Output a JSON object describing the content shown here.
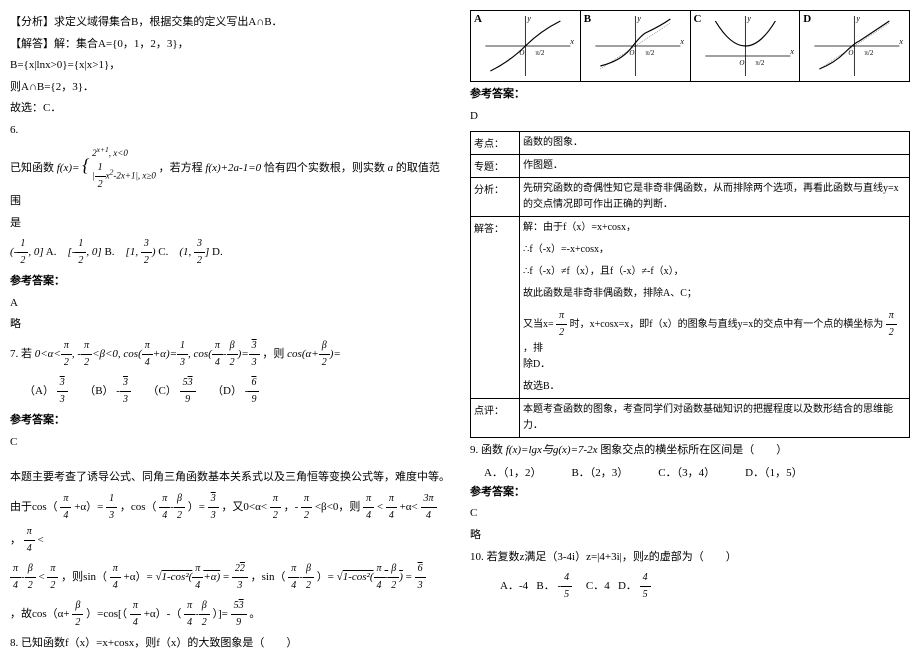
{
  "left": {
    "l1": "【分析】求定义域得集合B，根据交集的定义写出A∩B．",
    "l2": "【解答】解：集合A={0，1，2，3}，",
    "l3": "B={x|lnx>0}={x|x>1}，",
    "l4": "则A∩B={2，3}．",
    "l5": "故选：C．",
    "q6_num": "6.",
    "q6_a": "已知函数",
    "q6_b": "，若方程",
    "q6_c": "恰有四个实数根，则实数",
    "q6_d": "的取值范围",
    "q6_e": "是",
    "q6_optA": "A.",
    "q6_optB": "B.",
    "q6_optC": "C.",
    "q6_optD": "D.",
    "ans_label": "参考答案：",
    "q6_ans": "A",
    "q6_skip": "略",
    "q7_num": "7. 若",
    "q7_tail": "，则",
    "q7_optA": "（A）",
    "q7_optB": "（B）",
    "q7_optC": "（C）",
    "q7_optD": "（D）",
    "q7_ans": "C",
    "expl1": "本题主要考查了诱导公式、同角三角函数基本关系式以及三角恒等变换公式等，难度中等。",
    "expl2a": "由于cos（",
    "expl2b": "+α）=",
    "expl2c": "，cos（",
    "expl2d": "）=",
    "expl2e": "，又0<α<",
    "expl2f": "，-",
    "expl2g": "<β<0，则",
    "expl2h": "<",
    "expl2i": "+α<",
    "expl2j": "，",
    "expl2k": "<",
    "expl3a": "<",
    "expl3b": "，则sin（",
    "expl3c": "+α）=",
    "expl3d": "=",
    "expl3e": "，sin（",
    "expl3f": "）=",
    "expl3g": "=",
    "expl4a": "，故cos（α+",
    "expl4b": "）=cos[（",
    "expl4c": "+α）-（",
    "expl4d": "）]=",
    "expl4e": "。",
    "q8": "8. 已知函数f（x）=x+cosx，则f（x）的大致图象是（　　）"
  },
  "right": {
    "gA": "A",
    "gB": "B",
    "gC": "C",
    "gD": "D",
    "ans_label": "参考答案：",
    "g_ans": "D",
    "t_r1h": "考点：",
    "t_r1c": "函数的图象．",
    "t_r2h": "专题：",
    "t_r2c": "作图题．",
    "t_r3h": "分析：",
    "t_r3c": "先研究函数的奇偶性知它是非奇非偶函数，从而排除两个选项，再看此函数与直线y=x的交点情况即可作出正确的判断．",
    "t_r4h": "解答：",
    "t_r4_1": "解：由于f（x）=x+cosx，",
    "t_r4_2": "∴f（-x）=-x+cosx，",
    "t_r4_3": "∴f（-x）≠f（x），且f（-x）≠-f（x），",
    "t_r4_4": "故此函数是非奇非偶函数，排除A、C；",
    "t_r4_5a": "又当x=",
    "t_r4_5b": "时，x+cosx=x，即f（x）的图象与直线y=x的交点中有一个点的横坐标为",
    "t_r4_5c": "，排",
    "t_r4_6": "除D．",
    "t_r4_7": "故选B．",
    "t_r5h": "点评：",
    "t_r5c": "本题考查函数的图象，考查同学们对函数基础知识的把握程度以及数形结合的思维能力．",
    "q9a": "9. 函数",
    "q9b": "图象交点的横坐标所在区间是（　　）",
    "q9_A": "A．（1，2）",
    "q9_B": "B．（2，3）",
    "q9_C": "C．（3，4）",
    "q9_D": "D．（1，5）",
    "q9_ans": "C",
    "q9_skip": "略",
    "q10": "10. 若复数z满足（3-4i）z=|4+3i|，则z的虚部为（　　）",
    "q10_A": "A．-4",
    "q10_B": "B．",
    "q10_C": "C．4",
    "q10_D": "D．"
  }
}
